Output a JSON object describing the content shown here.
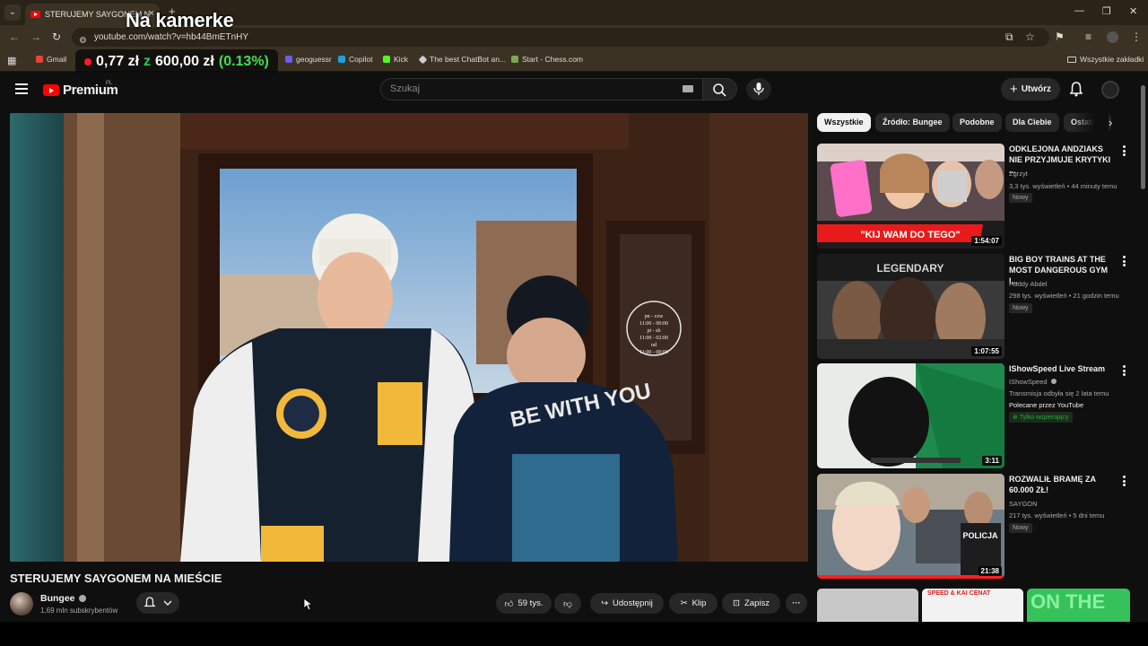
{
  "browser": {
    "tab_title": "STERUJEMY SAYGONEM N",
    "url": "youtube.com/watch?v=hb44BmETnHY",
    "bookmarks": [
      {
        "label": "Gmail",
        "color": "#ea4335"
      },
      {
        "label": "geoguessr",
        "color": "#6c5ce7"
      },
      {
        "label": "Copilot",
        "color": "#1fa0e0"
      },
      {
        "label": "Kick",
        "color": "#53fc18"
      },
      {
        "label": "The best ChatBot an...",
        "color": "#cccccc"
      },
      {
        "label": "Start - Chess.com",
        "color": "#7fa650"
      }
    ],
    "all_bookmarks": "Wszystkie zakładki"
  },
  "overlay": {
    "title": "Na kamerke",
    "price_from": "0,77 zł",
    "arrow": "z",
    "price_to": "600,00 zł",
    "percent": "(0.13%)"
  },
  "yt": {
    "logo_text": "Premium",
    "logo_sup": "PL",
    "search_placeholder": "Szukaj",
    "create_label": "Utwórz"
  },
  "video": {
    "title": "STERUJEMY SAYGONEM NA MIEŚCIE",
    "channel": "Bungee",
    "subscribers": "1,69 mln subskrybentów",
    "likes": "59 tys.",
    "share": "Udostępnij",
    "clip": "Klip",
    "save": "Zapisz",
    "window_sign": [
      "pn - czw",
      "11:00 - 00:00",
      "pt - sb",
      "11:00 - 02:00",
      "nd",
      "11:00 - 00:00"
    ]
  },
  "chips": [
    "Wszystkie",
    "Źródło: Bungee",
    "Podobne",
    "Dla Ciebie",
    "Ostatnio"
  ],
  "recommendations": [
    {
      "title": "ODKLEJONA ANDZIAKS NIE PRZYJMUJE KRYTYKI ...",
      "channel": "Zgrzyt",
      "meta": "3,3 tys. wyświetleń • 44 minuty temu",
      "badge": "Nowy",
      "duration": "1:54:07",
      "thumb_text": "\"KIJ WAM DO TEGO\""
    },
    {
      "title": "BIG BOY TRAINS AT THE MOST DANGEROUS GYM I...",
      "channel": "Haddy Abdel",
      "meta": "298 tys. wyświetleń • 21 godzin temu",
      "badge": "Nowy",
      "duration": "1:07:55",
      "thumb_text": "LEGENDARY"
    },
    {
      "title": "IShowSpeed Live Stream",
      "channel": "IShowSpeed",
      "meta": "Transmisja odbyła się 2 lata temu",
      "extra": "Polecane przez YouTube",
      "members": "Tylko wspierający",
      "duration": "3:11"
    },
    {
      "title": "ROZWALIŁ BRAMĘ ZA 60.000 ZŁ!",
      "channel": "SAYGON",
      "meta": "217 tys. wyświetleń • 5 dni temu",
      "badge": "Nowy",
      "duration": "21:38",
      "thumb_text": "POLICJA"
    }
  ],
  "partial_thumbs": {
    "second": "SPEED & KAI CENAT",
    "third": "ON THE"
  }
}
